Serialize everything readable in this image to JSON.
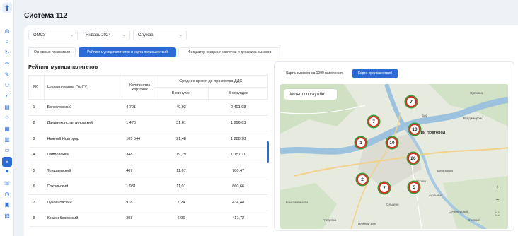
{
  "app": {
    "title": "Система 112"
  },
  "sidebar": {
    "items": [
      {
        "icon": "target-icon",
        "glyph": "◎"
      },
      {
        "icon": "building-icon",
        "glyph": "⌂"
      },
      {
        "icon": "refresh-icon",
        "glyph": "↻"
      },
      {
        "icon": "link-icon",
        "glyph": "∞"
      },
      {
        "icon": "pen-icon",
        "glyph": "✎"
      },
      {
        "icon": "users-icon",
        "glyph": "⚇"
      },
      {
        "icon": "check-circle-icon",
        "glyph": "✓"
      },
      {
        "icon": "document-icon",
        "glyph": "▤"
      },
      {
        "icon": "star-icon",
        "glyph": "☆"
      },
      {
        "icon": "calendar-icon",
        "glyph": "▦"
      },
      {
        "icon": "bar-chart-icon",
        "glyph": "▥"
      },
      {
        "icon": "chat-icon",
        "glyph": "▭"
      },
      {
        "icon": "ranking-icon",
        "glyph": "≡",
        "active": true
      },
      {
        "icon": "flag-icon",
        "glyph": "⚑"
      },
      {
        "icon": "phone-icon",
        "glyph": "☏"
      },
      {
        "icon": "clock-icon",
        "glyph": "◷"
      },
      {
        "icon": "calendar-check-icon",
        "glyph": "▣"
      },
      {
        "icon": "clipboard-icon",
        "glyph": "▧"
      }
    ]
  },
  "filters": {
    "region": "ОМСУ",
    "period": "Январь 2024",
    "service": "Служба"
  },
  "tabs": {
    "t1": "Основные показатели",
    "t2": "Рейтинг муниципалитетов и карта происшествий",
    "t3": "Инициатор создания карточки и динамика вызовов"
  },
  "rating": {
    "title": "Рейтинг муниципалитетов",
    "headers": {
      "num": "N9",
      "name": "Наименование ОМСУ",
      "count": "Количество карточек",
      "avg": "Среднее время до просмотра ДДС",
      "minutes": "В минутах",
      "seconds": "В секундах"
    },
    "rows": [
      {
        "n": "1",
        "name": "Богословский",
        "count": "4 701",
        "min": "40,03",
        "sec": "2 401,98",
        "color": "red"
      },
      {
        "n": "2",
        "name": "Дальнеконстантиновский",
        "count": "1 470",
        "min": "31,61",
        "sec": "1 896,63",
        "color": "red"
      },
      {
        "n": "3",
        "name": "Нижний Новгород",
        "count": "105 544",
        "min": "21,48",
        "sec": "1 288,98",
        "color": "red"
      },
      {
        "n": "4",
        "name": "Павловский",
        "count": "348",
        "min": "19,29",
        "sec": "1 157,11",
        "color": "red"
      },
      {
        "n": "5",
        "name": "Тонщаевский",
        "count": "407",
        "min": "11,67",
        "sec": "700,47",
        "color": "green"
      },
      {
        "n": "6",
        "name": "Сокольский",
        "count": "1 981",
        "min": "11,01",
        "sec": "660,66",
        "color": "red"
      },
      {
        "n": "7",
        "name": "Луковновский",
        "count": "918",
        "min": "7,24",
        "sec": "434,44",
        "color": "green"
      },
      {
        "n": "8",
        "name": "Краснобаковский",
        "count": "398",
        "min": "6,96",
        "sec": "417,72",
        "color": "green"
      }
    ]
  },
  "map": {
    "tab_calls": "Карта вызовов на 1000 населения",
    "tab_incidents": "Карта происшествий",
    "filter_placeholder": "Фильтр со службе",
    "city_label": "Нижний Новгород",
    "places": {
      "p1": "Бор",
      "p2": "Владимирово",
      "p3": "Орловка",
      "p4": "Берёзовка",
      "p5": "Кстово",
      "p6": "Афонино",
      "p7": "Сеченовский",
      "p8": "Степной",
      "p9": "Нижний Бек",
      "p10": "Ольгино",
      "p11": "Гледевка",
      "p12": "Константиново"
    },
    "markers": [
      "7",
      "7",
      "10",
      "1",
      "10",
      "20",
      "2",
      "7",
      "5"
    ],
    "zoom_in": "+",
    "zoom_out": "−",
    "fullscreen": "⛶"
  },
  "colors": {
    "accent": "#2c6ad6",
    "bad": "#e8453c",
    "good": "#46a34a"
  }
}
